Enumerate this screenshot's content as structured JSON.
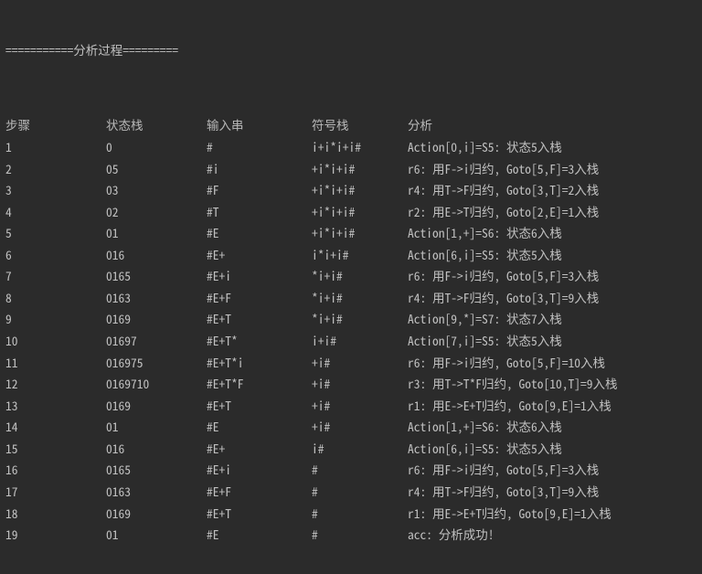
{
  "title": "===========分析过程=========",
  "headers": {
    "step": "步骤",
    "state_stack": "状态栈",
    "input": "输入串",
    "symbol_stack": "符号栈",
    "action": "分析"
  },
  "rows": [
    {
      "step": "1",
      "state": "0",
      "input": "#",
      "sym": "i+i*i+i#",
      "act": "Action[0,i]=S5: 状态5入栈"
    },
    {
      "step": "2",
      "state": "05",
      "input": "#i",
      "sym": "+i*i+i#",
      "act": "r6: 用F->i归约, Goto[5,F]=3入栈"
    },
    {
      "step": "3",
      "state": "03",
      "input": "#F",
      "sym": "+i*i+i#",
      "act": "r4: 用T->F归约, Goto[3,T]=2入栈"
    },
    {
      "step": "4",
      "state": "02",
      "input": "#T",
      "sym": "+i*i+i#",
      "act": "r2: 用E->T归约, Goto[2,E]=1入栈"
    },
    {
      "step": "5",
      "state": "01",
      "input": "#E",
      "sym": "+i*i+i#",
      "act": "Action[1,+]=S6: 状态6入栈"
    },
    {
      "step": "6",
      "state": "016",
      "input": "#E+",
      "sym": "i*i+i#",
      "act": "Action[6,i]=S5: 状态5入栈"
    },
    {
      "step": "7",
      "state": "0165",
      "input": "#E+i",
      "sym": "*i+i#",
      "act": "r6: 用F->i归约, Goto[5,F]=3入栈"
    },
    {
      "step": "8",
      "state": "0163",
      "input": "#E+F",
      "sym": "*i+i#",
      "act": "r4: 用T->F归约, Goto[3,T]=9入栈"
    },
    {
      "step": "9",
      "state": "0169",
      "input": "#E+T",
      "sym": "*i+i#",
      "act": "Action[9,*]=S7: 状态7入栈"
    },
    {
      "step": "10",
      "state": "01697",
      "input": "#E+T*",
      "sym": "i+i#",
      "act": "Action[7,i]=S5: 状态5入栈"
    },
    {
      "step": "11",
      "state": "016975",
      "input": "#E+T*i",
      "sym": "+i#",
      "act": "r6: 用F->i归约, Goto[5,F]=10入栈"
    },
    {
      "step": "12",
      "state": "0169710",
      "input": "#E+T*F",
      "sym": "+i#",
      "act": "r3: 用T->T*F归约, Goto[10,T]=9入栈"
    },
    {
      "step": "13",
      "state": "0169",
      "input": "#E+T",
      "sym": "+i#",
      "act": "r1: 用E->E+T归约, Goto[9,E]=1入栈"
    },
    {
      "step": "14",
      "state": "01",
      "input": "#E",
      "sym": "+i#",
      "act": "Action[1,+]=S6: 状态6入栈"
    },
    {
      "step": "15",
      "state": "016",
      "input": "#E+",
      "sym": "i#",
      "act": "Action[6,i]=S5: 状态5入栈"
    },
    {
      "step": "16",
      "state": "0165",
      "input": "#E+i",
      "sym": "#",
      "act": "r6: 用F->i归约, Goto[5,F]=3入栈"
    },
    {
      "step": "17",
      "state": "0163",
      "input": "#E+F",
      "sym": "#",
      "act": "r4: 用T->F归约, Goto[3,T]=9入栈"
    },
    {
      "step": "18",
      "state": "0169",
      "input": "#E+T",
      "sym": "#",
      "act": "r1: 用E->E+T归约, Goto[9,E]=1入栈"
    },
    {
      "step": "19",
      "state": "01",
      "input": "#E",
      "sym": "#",
      "act": "acc: 分析成功!"
    }
  ]
}
